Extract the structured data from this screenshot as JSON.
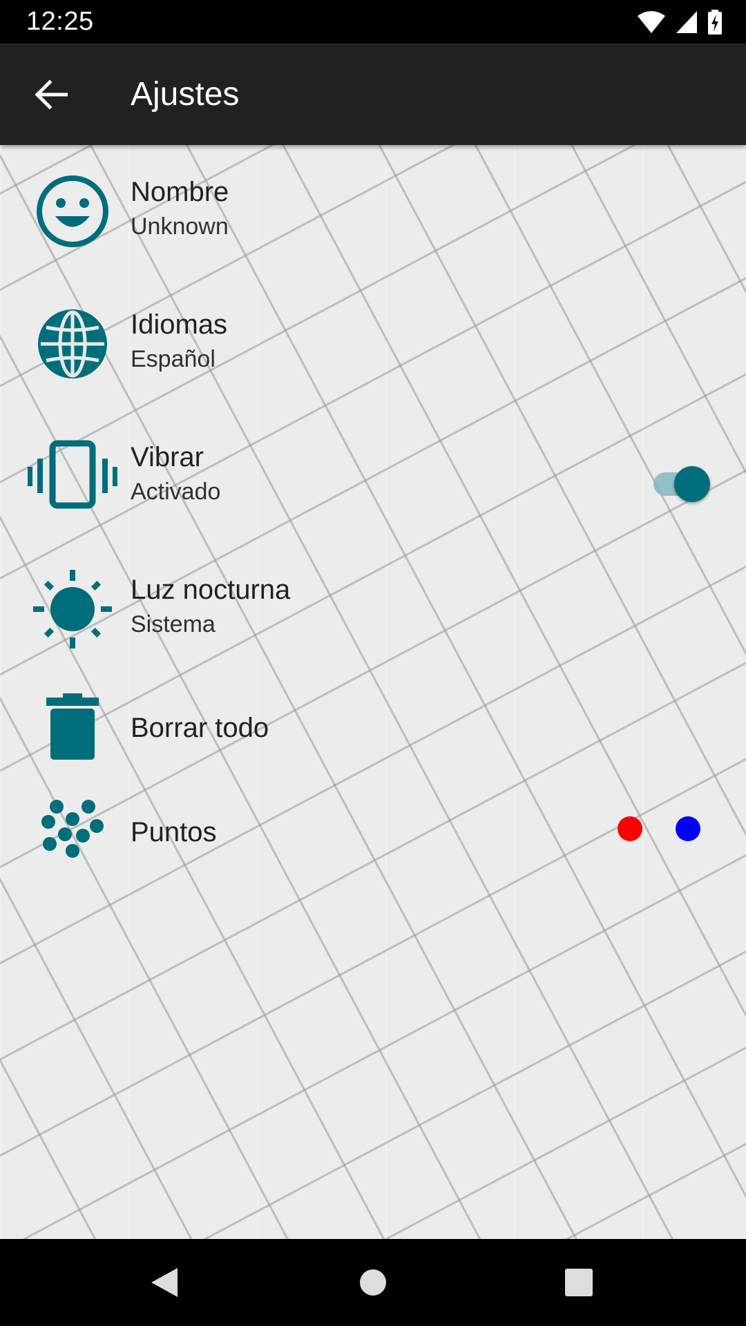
{
  "status_bar": {
    "time": "12:25"
  },
  "app_bar": {
    "title": "Ajustes"
  },
  "settings": {
    "nombre": {
      "title": "Nombre",
      "subtitle": "Unknown"
    },
    "idiomas": {
      "title": "Idiomas",
      "subtitle": "Español"
    },
    "vibrar": {
      "title": "Vibrar",
      "subtitle": "Activado",
      "enabled": true
    },
    "luz": {
      "title": "Luz nocturna",
      "subtitle": "Sistema"
    },
    "borrar": {
      "title": "Borrar todo"
    },
    "puntos": {
      "title": "Puntos",
      "colors": [
        "#ff0000",
        "#0000ff"
      ]
    }
  },
  "colors": {
    "accent": "#006e7a",
    "app_bar": "#212121"
  },
  "icons": {
    "nombre": "smiley-icon",
    "idiomas": "globe-icon",
    "vibrar": "vibrate-icon",
    "luz": "brightness-icon",
    "borrar": "trash-icon",
    "puntos": "dots-icon"
  }
}
